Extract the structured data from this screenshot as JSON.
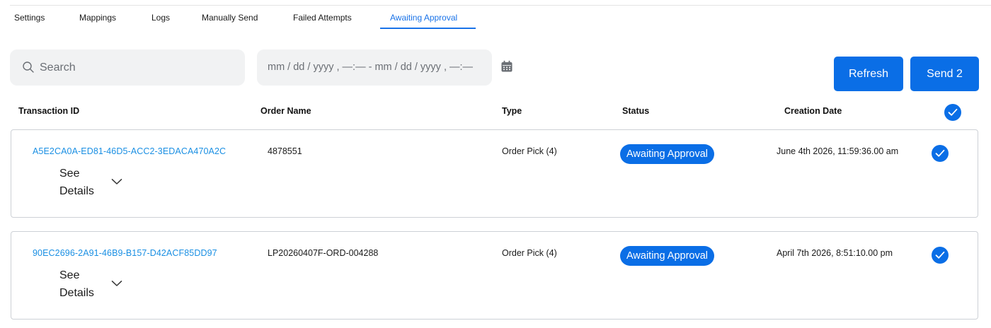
{
  "tabs": [
    {
      "label": "Settings"
    },
    {
      "label": "Mappings"
    },
    {
      "label": "Logs"
    },
    {
      "label": "Manually Send"
    },
    {
      "label": "Failed Attempts"
    },
    {
      "label": "Awaiting Approval"
    }
  ],
  "active_tab": "Awaiting Approval",
  "search": {
    "placeholder": "Search",
    "value": ""
  },
  "date_range": {
    "text": "mm / dd / yyyy , —:—  - mm / dd / yyyy , —:—"
  },
  "buttons": {
    "refresh": "Refresh",
    "send": "Send 2"
  },
  "columns": {
    "transaction_id": "Transaction ID",
    "order_name": "Order Name",
    "type": "Type",
    "status": "Status",
    "creation_date": "Creation Date"
  },
  "rows": [
    {
      "transaction_id": "A5E2CA0A-ED81-46D5-ACC2-3EDACA470A2C",
      "order_name": "4878551",
      "type": "Order Pick (4)",
      "status": "Awaiting Approval",
      "creation_date": "June 4th 2026, 11:59:36.00 am",
      "see_details_line1": "See",
      "see_details_line2": "Details",
      "selected": true
    },
    {
      "transaction_id": "90EC2696-2A91-46B9-B157-D42ACF85DD97",
      "order_name": "LP20260407F-ORD-004288",
      "type": "Order Pick (4)",
      "status": "Awaiting Approval",
      "creation_date": "April 7th 2026, 8:51:10.00 pm",
      "see_details_line1": "See",
      "see_details_line2": "Details",
      "selected": true
    }
  ],
  "select_all": true,
  "colors": {
    "accent": "#0a6ee6",
    "link": "#1a8fe3"
  },
  "icons": {
    "search": "search-icon",
    "calendar": "calendar-icon",
    "chevron": "chevron-down-icon",
    "check": "check-icon"
  }
}
